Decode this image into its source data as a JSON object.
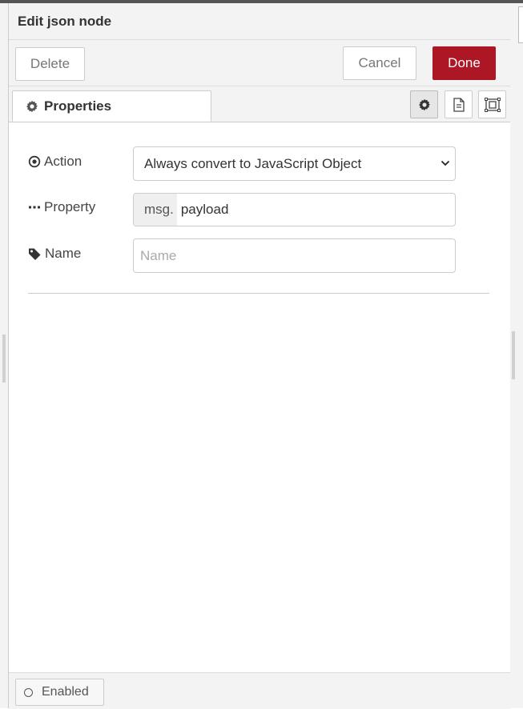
{
  "tray": {
    "title": "Edit json node"
  },
  "toolbar": {
    "delete_label": "Delete",
    "cancel_label": "Cancel",
    "done_label": "Done"
  },
  "tabs": {
    "properties_label": "Properties",
    "icon_buttons": [
      "gear-icon",
      "document-icon",
      "frame-icon"
    ]
  },
  "form": {
    "action": {
      "label": "Action",
      "icon": "dot-circle-icon",
      "selected": "Always convert to JavaScript Object"
    },
    "property": {
      "label": "Property",
      "icon": "ellipsis-icon",
      "prefix": "msg.",
      "value": "payload"
    },
    "name": {
      "label": "Name",
      "icon": "tag-icon",
      "value": "",
      "placeholder": "Name"
    }
  },
  "footer": {
    "enabled_label": "Enabled"
  },
  "colors": {
    "done_bg": "#ad1625",
    "panel_bg": "#f3f3f3",
    "border": "#cccccc"
  }
}
